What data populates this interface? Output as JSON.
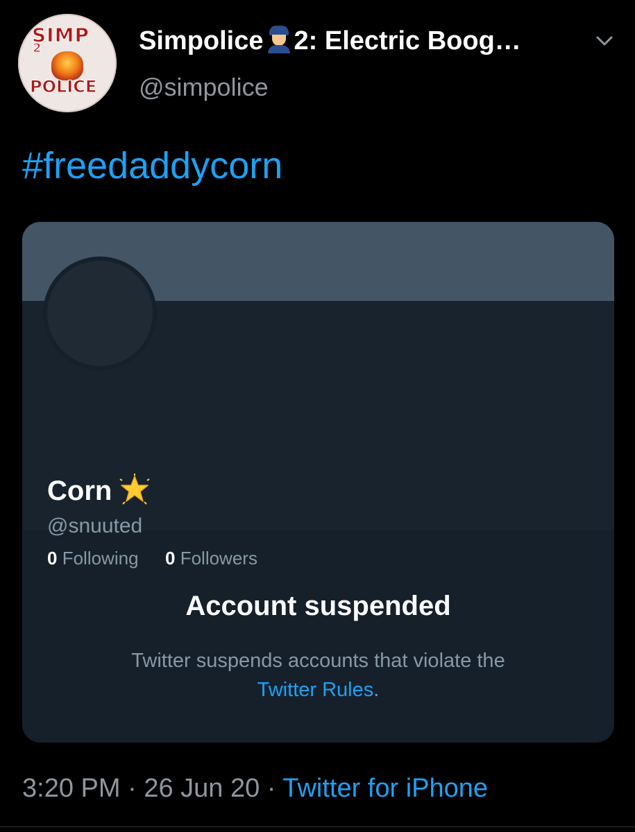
{
  "tweet": {
    "author": {
      "display_name": "Simpolice",
      "display_name_suffix": "2: Electric Boog…",
      "name_emoji": "police-officer-emoji",
      "handle": "@simpolice",
      "avatar": {
        "top_text": "SIMP",
        "number_text": "2",
        "bottom_text": "POLICE"
      }
    },
    "menu_icon": "chevron-down-icon",
    "hashtag": "#freedaddycorn",
    "embedded_profile": {
      "name": "Corn",
      "name_emoji": "glowing-star-emoji",
      "handle": "@snuuted",
      "following_count": "0",
      "following_label": "Following",
      "followers_count": "0",
      "followers_label": "Followers",
      "suspended_title": "Account suspended",
      "suspended_text": "Twitter suspends accounts that violate the",
      "rules_link": "Twitter Rules",
      "rules_suffix": "."
    },
    "meta": {
      "time": "3:20 PM",
      "separator": "·",
      "date": "26 Jun 20",
      "source": "Twitter for iPhone"
    }
  },
  "colors": {
    "background": "#000000",
    "link_blue": "#1da1f2",
    "card_bg": "#15202b",
    "banner": "#445566",
    "muted_text": "#8899a6"
  }
}
